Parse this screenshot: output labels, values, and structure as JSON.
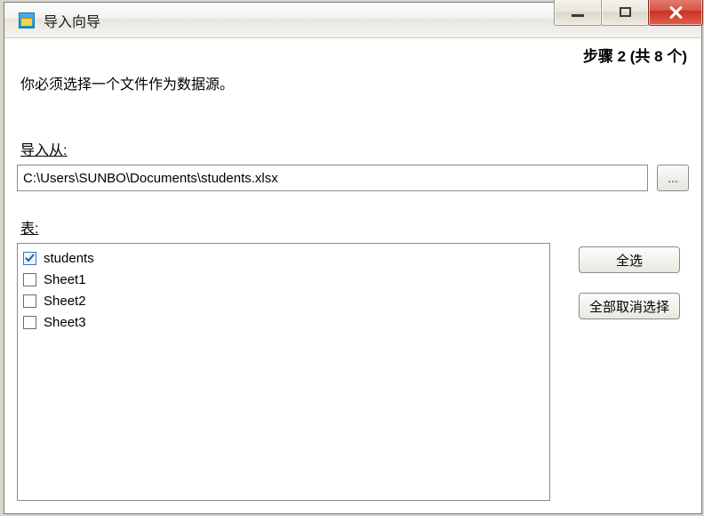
{
  "window": {
    "title": "导入向导"
  },
  "step": {
    "text": "步骤 2 (共 8 个)"
  },
  "instruction": "你必须选择一个文件作为数据源。",
  "importFrom": {
    "label": "导入从:",
    "value": "C:\\Users\\SUNBO\\Documents\\students.xlsx"
  },
  "browse": {
    "glyph": "..."
  },
  "tables": {
    "label": "表:",
    "items": [
      {
        "name": "students",
        "checked": true
      },
      {
        "name": "Sheet1",
        "checked": false
      },
      {
        "name": "Sheet2",
        "checked": false
      },
      {
        "name": "Sheet3",
        "checked": false
      }
    ]
  },
  "buttons": {
    "selectAll": "全选",
    "deselectAll": "全部取消选择"
  }
}
